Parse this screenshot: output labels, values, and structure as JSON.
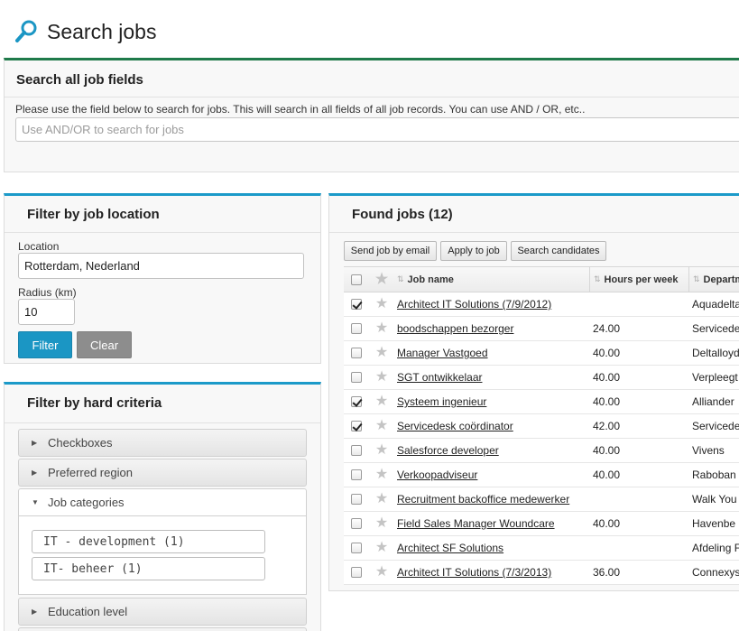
{
  "header": {
    "title": "Search jobs",
    "icon": "search-icon"
  },
  "search_panel": {
    "title": "Search all job fields",
    "description": "Please use the field below to search for jobs. This will search in all fields of all job records. You can use AND / OR, etc..",
    "placeholder": "Use AND/OR to search for jobs",
    "value": ""
  },
  "location_panel": {
    "title": "Filter by job location",
    "location_label": "Location",
    "location_value": "Rotterdam, Nederland",
    "radius_label": "Radius (km)",
    "radius_value": "10",
    "filter_label": "Filter",
    "clear_label": "Clear"
  },
  "criteria_panel": {
    "title": "Filter by hard criteria",
    "sections": [
      {
        "label": "Checkboxes",
        "expanded": false
      },
      {
        "label": "Preferred region",
        "expanded": false
      },
      {
        "label": "Job categories",
        "expanded": true
      },
      {
        "label": "Education level",
        "expanded": false
      }
    ],
    "categories": [
      "IT - development (1)",
      "IT- beheer (1)"
    ]
  },
  "found_panel": {
    "title": "Found jobs (12)",
    "buttons": [
      "Send job by email",
      "Apply to job",
      "Search candidates"
    ],
    "columns": {
      "name": "Job name",
      "hours": "Hours per week",
      "dept": "Departm"
    },
    "rows": [
      {
        "checked": true,
        "name": "Architect IT Solutions (7/9/2012)",
        "hours": "",
        "dept": "Aquadelta"
      },
      {
        "checked": false,
        "name": "boodschappen bezorger",
        "hours": "24.00",
        "dept": "Servicede"
      },
      {
        "checked": false,
        "name": "Manager Vastgoed",
        "hours": "40.00",
        "dept": "Deltalloyd"
      },
      {
        "checked": false,
        "name": "SGT ontwikkelaar",
        "hours": "40.00",
        "dept": "Verpleegt"
      },
      {
        "checked": true,
        "name": "Systeem ingenieur",
        "hours": "40.00",
        "dept": "Alliander"
      },
      {
        "checked": true,
        "name": "Servicedesk coördinator",
        "hours": "42.00",
        "dept": "Servicede"
      },
      {
        "checked": false,
        "name": "Salesforce developer",
        "hours": "40.00",
        "dept": "Vivens"
      },
      {
        "checked": false,
        "name": "Verkoopadviseur",
        "hours": "40.00",
        "dept": "Raboban"
      },
      {
        "checked": false,
        "name": "Recruitment backoffice medewerker",
        "hours": "",
        "dept": "Walk You"
      },
      {
        "checked": false,
        "name": "Field Sales Manager Woundcare",
        "hours": "40.00",
        "dept": "Havenbe"
      },
      {
        "checked": false,
        "name": "Architect SF Solutions",
        "hours": "",
        "dept": "Afdeling F"
      },
      {
        "checked": false,
        "name": "Architect IT Solutions (7/3/2013)",
        "hours": "36.00",
        "dept": "Connexys"
      }
    ]
  },
  "colors": {
    "accent_blue": "#1b96c4",
    "accent_green": "#1f7a4a",
    "clear_grey": "#8d8d8d"
  }
}
